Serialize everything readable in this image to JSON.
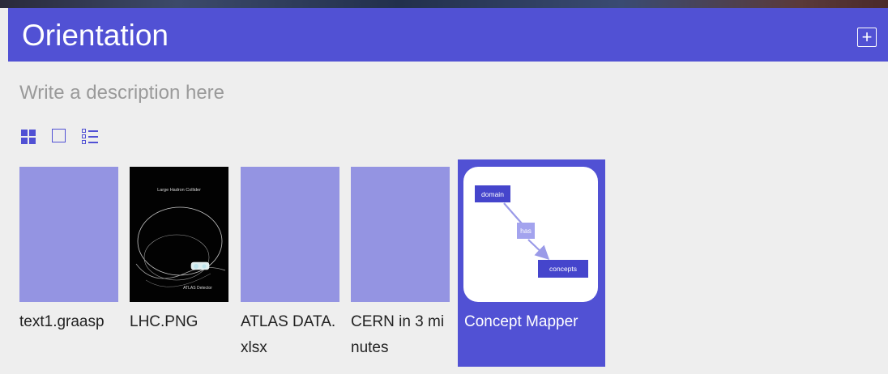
{
  "header": {
    "title": "Orientation",
    "add_icon": "plus-square-icon",
    "background": "#5151d4"
  },
  "description": {
    "placeholder": "Write a description here"
  },
  "view_modes": [
    {
      "name": "grid",
      "icon": "grid-icon",
      "selected": true
    },
    {
      "name": "single",
      "icon": "square-icon",
      "selected": false
    },
    {
      "name": "list",
      "icon": "list-icon",
      "selected": false
    }
  ],
  "tiles": [
    {
      "label": "text1.graasp",
      "thumbnail": "placeholder",
      "selected": false
    },
    {
      "label": "LHC.PNG",
      "thumbnail": "image",
      "image_text": {
        "top": "Large Hadron Collider",
        "bottom": "ATLAS Detector"
      },
      "selected": false
    },
    {
      "label": "ATLAS DATA.xlsx",
      "thumbnail": "placeholder",
      "selected": false
    },
    {
      "label": "CERN in 3 minutes",
      "thumbnail": "placeholder",
      "selected": false
    },
    {
      "label": "Concept Mapper",
      "thumbnail": "concept-map",
      "concept_map": {
        "node1": "domain",
        "edge": "has",
        "node2": "concepts"
      },
      "selected": true
    }
  ],
  "colors": {
    "accent": "#5151d4",
    "placeholder_thumb": "#9494e2",
    "background": "#eeeeee"
  }
}
